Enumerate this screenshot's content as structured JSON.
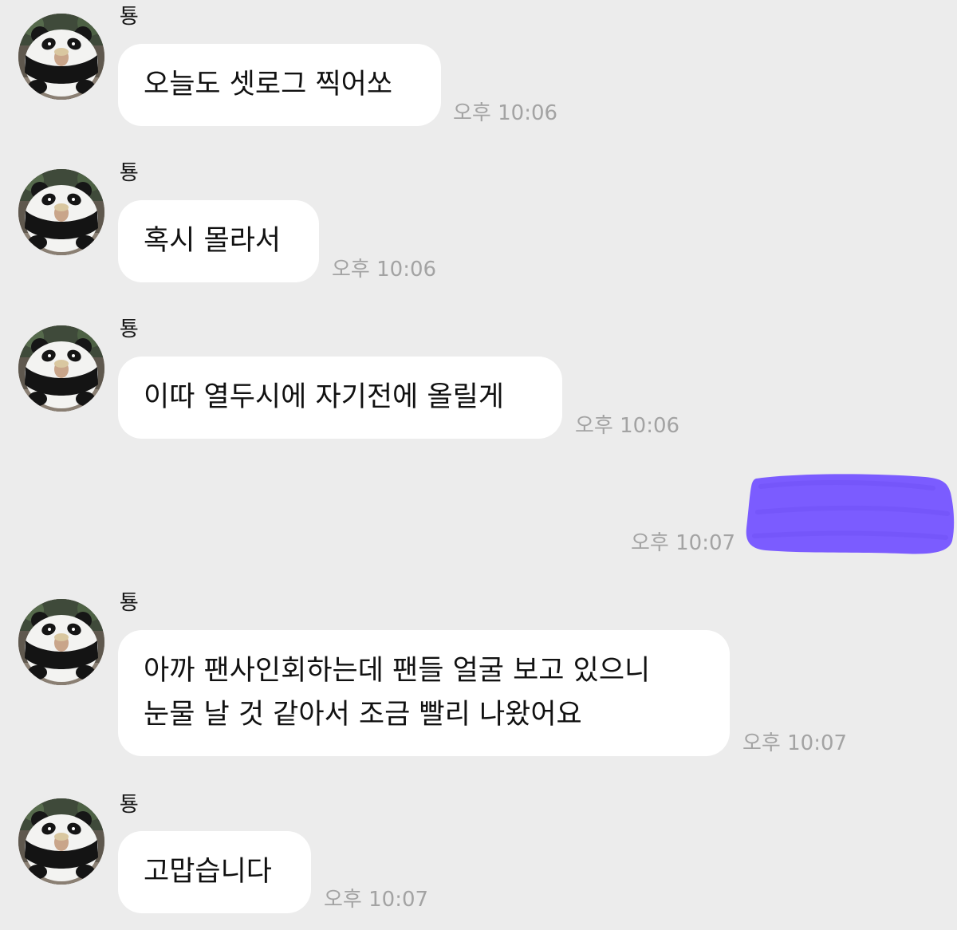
{
  "colors": {
    "background": "#ececec",
    "bubble_incoming": "#ffffff",
    "timestamp": "#a3a3a3",
    "redaction": "#7b5cff"
  },
  "messages": [
    {
      "sender": "툥",
      "avatar_icon": "panda-statue-avatar-icon",
      "lines": [
        "오늘도 셋로그 찍어쏘"
      ],
      "time": "오후 10:06"
    },
    {
      "sender": "툥",
      "avatar_icon": "panda-statue-avatar-icon",
      "lines": [
        "혹시 몰라서"
      ],
      "time": "오후 10:06"
    },
    {
      "sender": "툥",
      "avatar_icon": "panda-statue-avatar-icon",
      "lines": [
        "이따 열두시에 자기전에 올릴게"
      ],
      "time": "오후 10:06"
    },
    {
      "sender": "me",
      "redacted": true,
      "time": "오후 10:07"
    },
    {
      "sender": "툥",
      "avatar_icon": "panda-statue-avatar-icon",
      "lines": [
        "아까 팬사인회하는데 팬들 얼굴 보고 있으니",
        "눈물 날 것 같아서 조금 빨리 나왔어요"
      ],
      "time": "오후 10:07"
    },
    {
      "sender": "툥",
      "avatar_icon": "panda-statue-avatar-icon",
      "lines": [
        "고맙습니다"
      ],
      "time": "오후 10:07"
    }
  ]
}
